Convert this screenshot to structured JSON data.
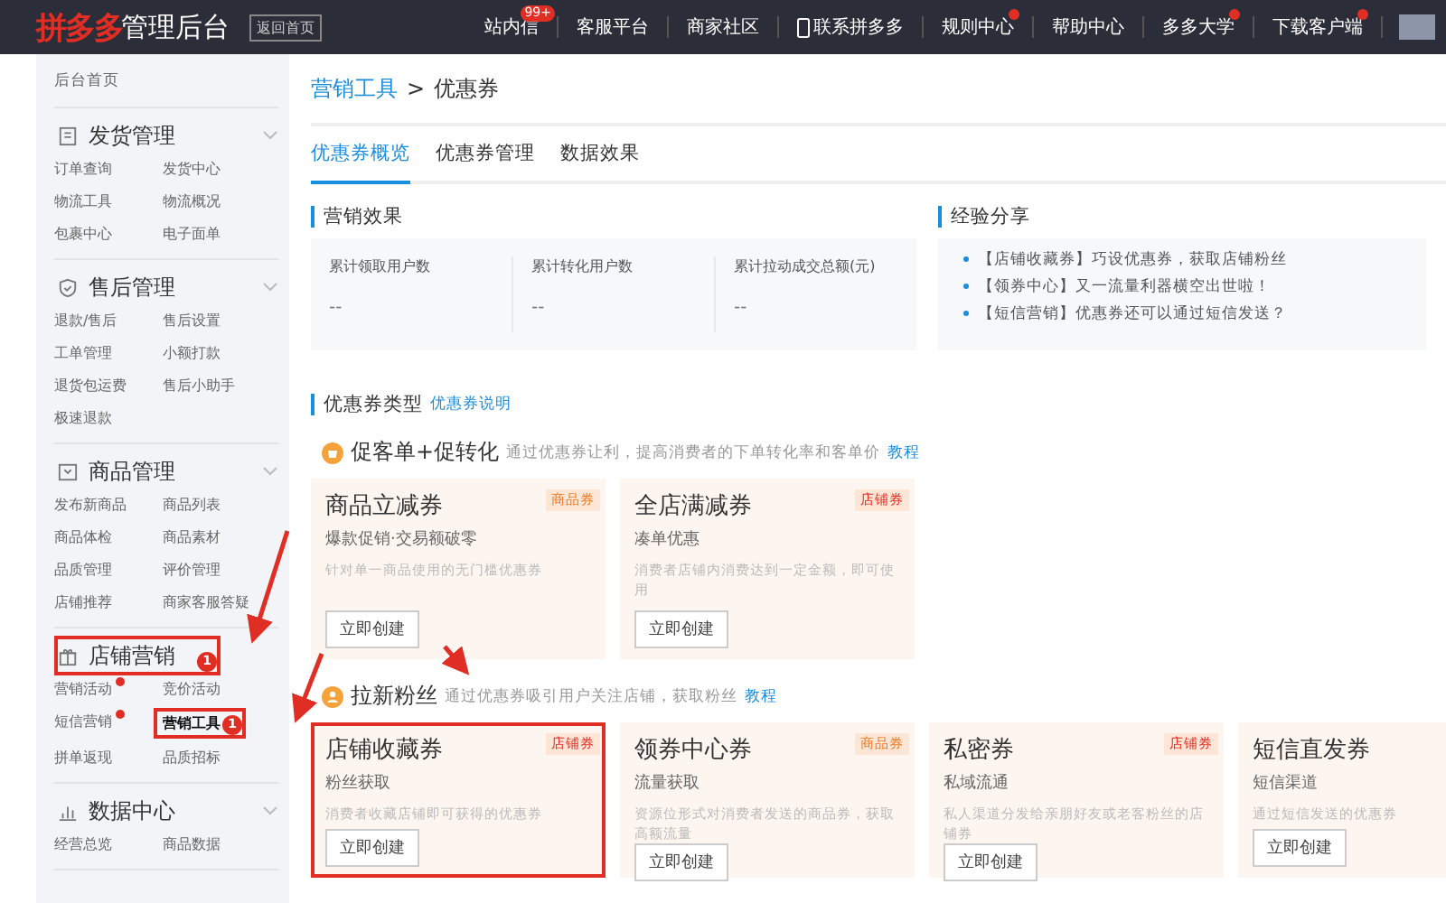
{
  "top_bar": {
    "brand": "拼多多",
    "title": "管理后台",
    "home_link": "返回首页",
    "nav": [
      {
        "label": "站内信",
        "kind": "text",
        "dot": false,
        "badge": "99+"
      },
      {
        "label": "客服平台",
        "kind": "text",
        "dot": false
      },
      {
        "label": "商家社区",
        "kind": "text",
        "dot": false
      },
      {
        "label": "联系拼多多",
        "kind": "phone",
        "dot": false
      },
      {
        "label": "规则中心",
        "kind": "text",
        "dot": true
      },
      {
        "label": "帮助中心",
        "kind": "text",
        "dot": false
      },
      {
        "label": "多多大学",
        "kind": "text",
        "dot": true
      },
      {
        "label": "下载客户端",
        "kind": "text",
        "dot": true
      }
    ]
  },
  "sidebar": {
    "home": "后台首页",
    "sections": [
      {
        "title": "发货管理",
        "kind": "document",
        "highlighted": false,
        "items": [
          {
            "label": "订单查询",
            "selected": false,
            "dot": false,
            "highlighted": false
          },
          {
            "label": "发货中心",
            "selected": false,
            "dot": false,
            "highlighted": false
          },
          {
            "label": "物流工具",
            "selected": false,
            "dot": false,
            "highlighted": false
          },
          {
            "label": "物流概况",
            "selected": false,
            "dot": false,
            "highlighted": false
          },
          {
            "label": "包裹中心",
            "selected": false,
            "dot": false,
            "highlighted": false
          },
          {
            "label": "电子面单",
            "selected": false,
            "dot": false,
            "highlighted": false
          }
        ]
      },
      {
        "title": "售后管理",
        "kind": "shield",
        "highlighted": false,
        "items": [
          {
            "label": "退款/售后",
            "selected": false,
            "dot": false,
            "highlighted": false
          },
          {
            "label": "售后设置",
            "selected": false,
            "dot": false,
            "highlighted": false
          },
          {
            "label": "工单管理",
            "selected": false,
            "dot": false,
            "highlighted": false
          },
          {
            "label": "小额打款",
            "selected": false,
            "dot": false,
            "highlighted": false
          },
          {
            "label": "退货包运费",
            "selected": false,
            "dot": false,
            "highlighted": false
          },
          {
            "label": "售后小助手",
            "selected": false,
            "dot": false,
            "highlighted": false
          },
          {
            "label": "极速退款",
            "selected": false,
            "dot": false,
            "highlighted": false
          }
        ]
      },
      {
        "title": "商品管理",
        "kind": "box",
        "highlighted": false,
        "items": [
          {
            "label": "发布新商品",
            "selected": false,
            "dot": false,
            "highlighted": false
          },
          {
            "label": "商品列表",
            "selected": false,
            "dot": false,
            "highlighted": false
          },
          {
            "label": "商品体检",
            "selected": false,
            "dot": false,
            "highlighted": false
          },
          {
            "label": "商品素材",
            "selected": false,
            "dot": false,
            "highlighted": false
          },
          {
            "label": "品质管理",
            "selected": false,
            "dot": false,
            "highlighted": false
          },
          {
            "label": "评价管理",
            "selected": false,
            "dot": false,
            "highlighted": false
          },
          {
            "label": "店铺推荐",
            "selected": false,
            "dot": false,
            "highlighted": false
          },
          {
            "label": "商家客服答疑",
            "selected": false,
            "dot": false,
            "highlighted": false
          }
        ]
      },
      {
        "title": "店铺营销",
        "kind": "gift",
        "highlighted": true,
        "badge": "1",
        "items": [
          {
            "label": "营销活动",
            "selected": false,
            "dot": true,
            "highlighted": false
          },
          {
            "label": "竞价活动",
            "selected": false,
            "dot": false,
            "highlighted": false
          },
          {
            "label": "短信营销",
            "selected": false,
            "dot": true,
            "highlighted": false
          },
          {
            "label": "营销工具",
            "selected": true,
            "dot": false,
            "highlighted": true,
            "badge": "1"
          },
          {
            "label": "拼单返现",
            "selected": false,
            "dot": false,
            "highlighted": false
          },
          {
            "label": "品质招标",
            "selected": false,
            "dot": false,
            "highlighted": false
          }
        ]
      },
      {
        "title": "数据中心",
        "kind": "chart",
        "highlighted": false,
        "items": [
          {
            "label": "经营总览",
            "selected": false,
            "dot": false,
            "highlighted": false
          },
          {
            "label": "商品数据",
            "selected": false,
            "dot": false,
            "highlighted": false
          }
        ]
      }
    ]
  },
  "breadcrumb": {
    "parent": "营销工具",
    "separator": ">",
    "current": "优惠券"
  },
  "tabs": [
    {
      "label": "优惠券概览",
      "selected": true
    },
    {
      "label": "优惠券管理",
      "selected": false
    },
    {
      "label": "数据效果",
      "selected": false
    }
  ],
  "marketing_effect": {
    "title": "营销效果",
    "stats": [
      {
        "label": "累计领取用户数",
        "value": "--"
      },
      {
        "label": "累计转化用户数",
        "value": "--"
      },
      {
        "label": "累计拉动成交总额(元)",
        "value": "--"
      }
    ]
  },
  "experience": {
    "title": "经验分享",
    "items": [
      "【店铺收藏券】巧设优惠券，获取店铺粉丝",
      "【领券中心】又一流量利器横空出世啦！",
      "【短信营销】优惠券还可以通过短信发送？"
    ]
  },
  "coupon_types": {
    "title": "优惠券类型",
    "link": "优惠券说明",
    "groups": [
      {
        "title": "促客单+促转化",
        "kind": "cart",
        "description": "通过优惠券让利，提高消费者的下单转化率和客单价",
        "link": "教程",
        "cards": [
          {
            "name": "商品立减券",
            "tag": "商品券",
            "color": "#f07a20",
            "subtitle": "爆款促销·交易额破零",
            "description": "针对单一商品使用的无门槛优惠券",
            "button": "立即创建",
            "highlighted": false
          },
          {
            "name": "全店满减券",
            "tag": "店铺券",
            "color": "#e02e24",
            "subtitle": "凑单优惠",
            "description": "消费者店铺内消费达到一定金额，即可使用",
            "button": "立即创建",
            "highlighted": false
          }
        ]
      },
      {
        "title": "拉新粉丝",
        "kind": "person",
        "description": "通过优惠券吸引用户关注店铺，获取粉丝",
        "link": "教程",
        "cards": [
          {
            "name": "店铺收藏券",
            "tag": "店铺券",
            "color": "#e02e24",
            "subtitle": "粉丝获取",
            "description": "消费者收藏店铺即可获得的优惠券",
            "button": "立即创建",
            "highlighted": true
          },
          {
            "name": "领券中心券",
            "tag": "商品券",
            "color": "#f07a20",
            "subtitle": "流量获取",
            "description": "资源位形式对消费者发送的商品券，获取高额流量",
            "button": "立即创建",
            "highlighted": false
          },
          {
            "name": "私密券",
            "tag": "店铺券",
            "color": "#e02e24",
            "subtitle": "私域流通",
            "description": "私人渠道分发给亲朋好友或老客粉丝的店铺券",
            "button": "立即创建",
            "highlighted": false
          },
          {
            "name": "短信直发券",
            "subtitle": "短信渠道",
            "description": "通过短信发送的优惠券",
            "button": "立即创建",
            "highlighted": false
          }
        ]
      }
    ]
  }
}
